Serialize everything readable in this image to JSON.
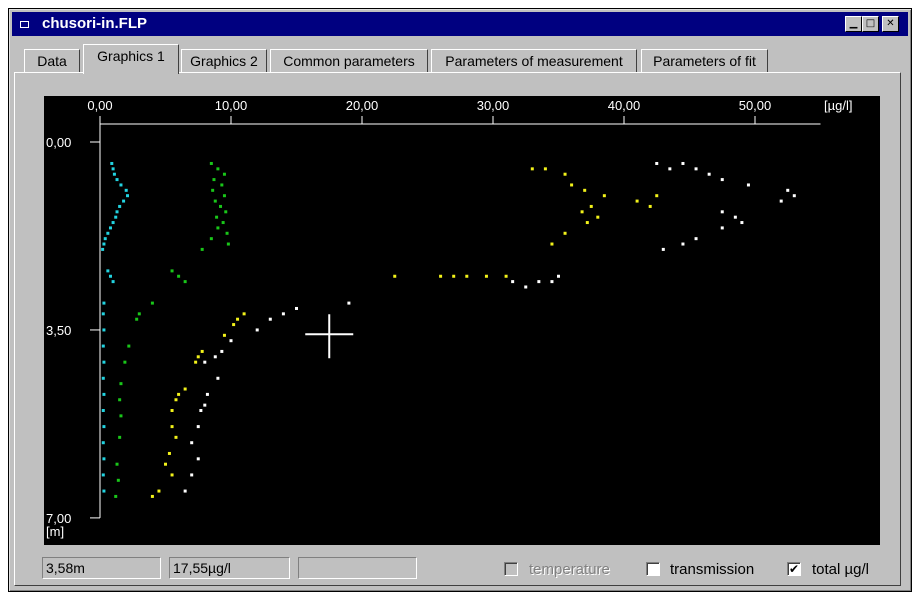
{
  "window": {
    "title": "chusori-in.FLP"
  },
  "tabs": [
    {
      "label": "Data",
      "active": false
    },
    {
      "label": "Graphics 1",
      "active": true
    },
    {
      "label": "Graphics 2",
      "active": false
    },
    {
      "label": "Common parameters",
      "active": false
    },
    {
      "label": "Parameters of measurement",
      "active": false
    },
    {
      "label": "Parameters of fit",
      "active": false
    }
  ],
  "status": {
    "depth": "3,58m",
    "value": "17,55µg/l",
    "empty": ""
  },
  "checkboxes": {
    "temperature": {
      "label": "temperature",
      "checked": false,
      "enabled": false
    },
    "transmission": {
      "label": "transmission",
      "checked": false,
      "enabled": true
    },
    "total": {
      "label": "total µg/l",
      "checked": true,
      "enabled": true
    }
  },
  "colors": {
    "cyan": "#22d3e0",
    "green": "#19c619",
    "yellow": "#f2f21a",
    "white": "#ffffff",
    "background": "#000000"
  },
  "chart_data": {
    "type": "scatter",
    "x_axis": {
      "unit_label": "[µg/l]",
      "ticks": [
        "0,00",
        "10,00",
        "20,00",
        "30,00",
        "40,00",
        "50,00"
      ],
      "range": [
        0,
        55
      ],
      "position": "top"
    },
    "y_axis": {
      "unit_label": "[m]",
      "ticks": [
        "0,00",
        "3,50",
        "7,00"
      ],
      "range": [
        0,
        7
      ],
      "inverted": true
    },
    "cursor": {
      "x": 17.5,
      "y": 3.58
    },
    "series": [
      {
        "color_key": "cyan",
        "points": [
          [
            0.9,
            0.4
          ],
          [
            1.0,
            0.5
          ],
          [
            1.1,
            0.6
          ],
          [
            1.3,
            0.7
          ],
          [
            1.6,
            0.8
          ],
          [
            2.0,
            0.9
          ],
          [
            2.1,
            1.0
          ],
          [
            1.8,
            1.1
          ],
          [
            1.5,
            1.2
          ],
          [
            1.3,
            1.3
          ],
          [
            1.2,
            1.4
          ],
          [
            1.0,
            1.5
          ],
          [
            0.8,
            1.6
          ],
          [
            0.6,
            1.7
          ],
          [
            0.4,
            1.8
          ],
          [
            0.3,
            1.9
          ],
          [
            0.2,
            2.0
          ],
          [
            0.6,
            2.4
          ],
          [
            0.8,
            2.5
          ],
          [
            1.0,
            2.6
          ],
          [
            0.3,
            3.0
          ],
          [
            0.25,
            3.2
          ],
          [
            0.3,
            3.5
          ],
          [
            0.25,
            3.8
          ],
          [
            0.3,
            4.1
          ],
          [
            0.25,
            4.4
          ],
          [
            0.3,
            4.7
          ],
          [
            0.25,
            5.0
          ],
          [
            0.3,
            5.3
          ],
          [
            0.25,
            5.6
          ],
          [
            0.3,
            5.9
          ],
          [
            0.25,
            6.2
          ],
          [
            0.3,
            6.5
          ]
        ]
      },
      {
        "color_key": "green",
        "points": [
          [
            8.5,
            0.4
          ],
          [
            9.0,
            0.5
          ],
          [
            9.5,
            0.6
          ],
          [
            8.7,
            0.7
          ],
          [
            9.3,
            0.8
          ],
          [
            8.6,
            0.9
          ],
          [
            9.5,
            1.0
          ],
          [
            8.8,
            1.1
          ],
          [
            9.2,
            1.2
          ],
          [
            9.6,
            1.3
          ],
          [
            8.9,
            1.4
          ],
          [
            9.4,
            1.5
          ],
          [
            9.0,
            1.6
          ],
          [
            9.7,
            1.7
          ],
          [
            8.5,
            1.8
          ],
          [
            9.8,
            1.9
          ],
          [
            7.8,
            2.0
          ],
          [
            5.5,
            2.4
          ],
          [
            6.0,
            2.5
          ],
          [
            6.5,
            2.6
          ],
          [
            4.0,
            3.0
          ],
          [
            3.0,
            3.2
          ],
          [
            2.8,
            3.3
          ],
          [
            2.2,
            3.8
          ],
          [
            1.9,
            4.1
          ],
          [
            1.6,
            4.5
          ],
          [
            1.5,
            4.8
          ],
          [
            1.6,
            5.1
          ],
          [
            1.5,
            5.5
          ],
          [
            1.3,
            6.0
          ],
          [
            1.4,
            6.3
          ],
          [
            1.2,
            6.6
          ]
        ]
      },
      {
        "color_key": "yellow",
        "points": [
          [
            33.0,
            0.5
          ],
          [
            34.0,
            0.5
          ],
          [
            35.5,
            0.6
          ],
          [
            36.0,
            0.8
          ],
          [
            37.0,
            0.9
          ],
          [
            38.5,
            1.0
          ],
          [
            37.5,
            1.2
          ],
          [
            36.8,
            1.3
          ],
          [
            38.0,
            1.4
          ],
          [
            37.2,
            1.5
          ],
          [
            35.5,
            1.7
          ],
          [
            34.5,
            1.9
          ],
          [
            41.0,
            1.1
          ],
          [
            42.0,
            1.2
          ],
          [
            42.5,
            1.0
          ],
          [
            22.5,
            2.5
          ],
          [
            26.0,
            2.5
          ],
          [
            27.0,
            2.5
          ],
          [
            28.0,
            2.5
          ],
          [
            29.5,
            2.5
          ],
          [
            31.0,
            2.5
          ],
          [
            11.0,
            3.2
          ],
          [
            10.5,
            3.3
          ],
          [
            10.2,
            3.4
          ],
          [
            9.5,
            3.6
          ],
          [
            7.8,
            3.9
          ],
          [
            7.5,
            4.0
          ],
          [
            7.3,
            4.1
          ],
          [
            6.5,
            4.6
          ],
          [
            6.0,
            4.7
          ],
          [
            5.8,
            4.8
          ],
          [
            5.5,
            5.0
          ],
          [
            5.5,
            5.3
          ],
          [
            5.8,
            5.5
          ],
          [
            5.3,
            5.8
          ],
          [
            5.0,
            6.0
          ],
          [
            5.5,
            6.2
          ],
          [
            4.5,
            6.5
          ],
          [
            4.0,
            6.6
          ]
        ]
      },
      {
        "color_key": "white",
        "points": [
          [
            42.5,
            0.4
          ],
          [
            43.5,
            0.5
          ],
          [
            44.5,
            0.4
          ],
          [
            45.5,
            0.5
          ],
          [
            46.5,
            0.6
          ],
          [
            47.5,
            0.7
          ],
          [
            49.5,
            0.8
          ],
          [
            52.5,
            0.9
          ],
          [
            53.0,
            1.0
          ],
          [
            52.0,
            1.1
          ],
          [
            47.5,
            1.3
          ],
          [
            48.5,
            1.4
          ],
          [
            49.0,
            1.5
          ],
          [
            47.5,
            1.6
          ],
          [
            45.5,
            1.8
          ],
          [
            44.5,
            1.9
          ],
          [
            43.0,
            2.0
          ],
          [
            35.0,
            2.5
          ],
          [
            34.5,
            2.6
          ],
          [
            33.5,
            2.6
          ],
          [
            32.5,
            2.7
          ],
          [
            31.5,
            2.6
          ],
          [
            19.0,
            3.0
          ],
          [
            15.0,
            3.1
          ],
          [
            14.0,
            3.2
          ],
          [
            13.0,
            3.3
          ],
          [
            12.0,
            3.5
          ],
          [
            10.0,
            3.7
          ],
          [
            9.3,
            3.9
          ],
          [
            8.8,
            4.0
          ],
          [
            8.0,
            4.1
          ],
          [
            9.0,
            4.4
          ],
          [
            8.2,
            4.7
          ],
          [
            8.0,
            4.9
          ],
          [
            7.7,
            5.0
          ],
          [
            7.5,
            5.3
          ],
          [
            7.0,
            5.6
          ],
          [
            7.5,
            5.9
          ],
          [
            7.0,
            6.2
          ],
          [
            6.5,
            6.5
          ]
        ]
      }
    ]
  }
}
